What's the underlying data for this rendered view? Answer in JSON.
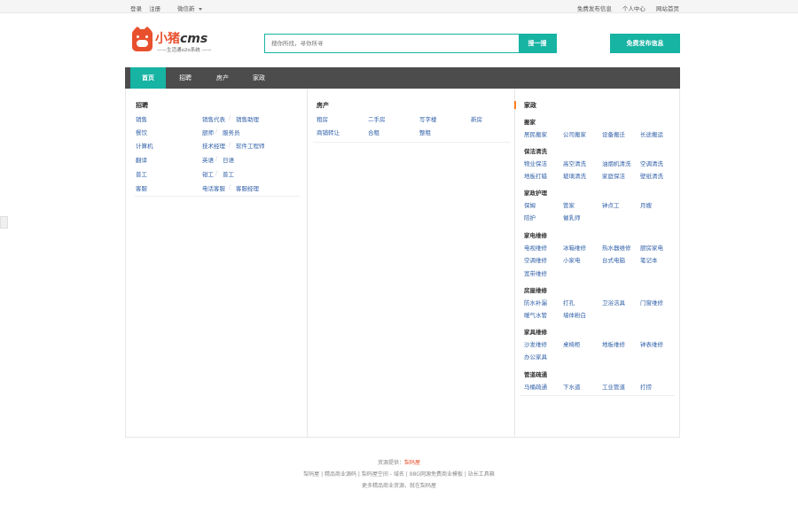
{
  "topbar": {
    "login": "登录",
    "register": "注册",
    "wechat": "微信新",
    "right_links": [
      "免费发布信息",
      "个人中心",
      "网站首页"
    ]
  },
  "logo": {
    "brand_cn": "小猪",
    "brand_en": "cms",
    "slogan": "——生活通o2o系统 ——"
  },
  "search": {
    "placeholder": "搜你所找，寻你所寻",
    "button": "搜一搜"
  },
  "post_button": "免费发布信息",
  "nav": [
    "首页",
    "招聘",
    "房产",
    "家政"
  ],
  "recruit": {
    "title": "招聘",
    "rows": [
      {
        "cat": "销售",
        "items": [
          "销售代表",
          "销售助理"
        ]
      },
      {
        "cat": "餐饮",
        "items": [
          "厨师",
          "服务员"
        ]
      },
      {
        "cat": "计算机",
        "items": [
          "技术经理",
          "软件工程师"
        ]
      },
      {
        "cat": "翻译",
        "items": [
          "英语",
          "日语"
        ]
      },
      {
        "cat": "普工",
        "items": [
          "钳工",
          "普工"
        ]
      },
      {
        "cat": "客服",
        "items": [
          "电话客服",
          "客服经理"
        ]
      }
    ]
  },
  "house": {
    "title": "房产",
    "items": [
      "租房",
      "二手房",
      "写字楼",
      "新房",
      "商铺转让",
      "合租",
      "整租"
    ]
  },
  "homeservice": {
    "title": "家政",
    "groups": [
      {
        "name": "搬家",
        "items": [
          "居民搬家",
          "公司搬家",
          "设备搬迁",
          "长途搬运"
        ]
      },
      {
        "name": "保洁清洗",
        "items": [
          "物业保洁",
          "高空清洗",
          "油烟机清洗",
          "空调清洗",
          "地板打蜡",
          "玻璃清洗",
          "家庭保洁",
          "壁纸清洗"
        ]
      },
      {
        "name": "家政护理",
        "items": [
          "保姆",
          "管家",
          "钟点工",
          "月嫂",
          "陪护",
          "催乳师"
        ]
      },
      {
        "name": "家电维修",
        "items": [
          "电视维修",
          "冰箱维修",
          "热水器维修",
          "厨房家电",
          "空调维修",
          "小家电",
          "台式电脑",
          "笔记本",
          "宽带维修"
        ]
      },
      {
        "name": "房屋维修",
        "items": [
          "防水补漏",
          "打孔",
          "卫浴洁具",
          "门窗维修",
          "暖气水管",
          "墙体粉白"
        ]
      },
      {
        "name": "家具维修",
        "items": [
          "沙发维修",
          "桌椅柜",
          "地板维修",
          "钟表维修",
          "办公家具"
        ]
      },
      {
        "name": "管道疏通",
        "items": [
          "马桶疏通",
          "下水道",
          "工业管道",
          "打捞"
        ]
      }
    ]
  },
  "footer": {
    "line1_prefix": "资源提供：",
    "line1_name": "梨码屋",
    "line2": "梨码屋 | 精品商业源码 | 梨码屋空间 - 域名 | 98G网源免费商业模板 | 站长工具箱",
    "line3": "更多精品商业资源，就在梨码屋"
  }
}
